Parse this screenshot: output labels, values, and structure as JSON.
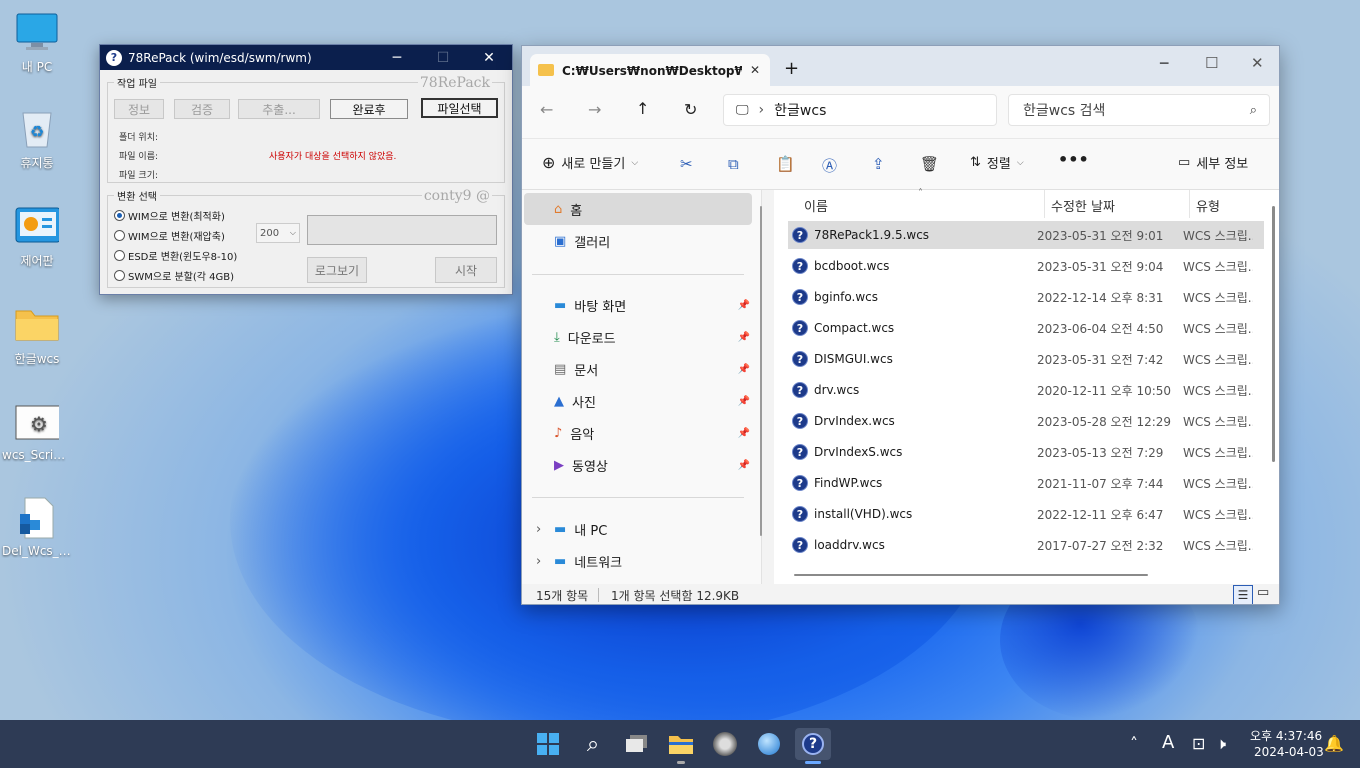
{
  "desktop": {
    "icons": [
      {
        "label": "내 PC",
        "icon": "monitor-icon"
      },
      {
        "label": "휴지통",
        "icon": "recycle-bin-icon"
      },
      {
        "label": "제어판",
        "icon": "control-panel-icon"
      },
      {
        "label": "한글wcs",
        "icon": "folder-icon"
      },
      {
        "label": "wcs_Script...",
        "icon": "settings-file-icon"
      },
      {
        "label": "Del_Wcs_S...",
        "icon": "script-file-icon"
      }
    ]
  },
  "repack": {
    "title": "78RePack (wim/esd/swm/rwm)",
    "group1_label": "작업 파일",
    "watermark1": "78RePack",
    "buttons": {
      "info": "정보",
      "verify": "검증",
      "extract": "추출...",
      "after": "완료후",
      "select": "파일선택"
    },
    "folder_label": "폴더 위치:",
    "name_label": "파일 이름:",
    "size_label": "파일 크기:",
    "status_msg": "사용자가 대상을 선택하지 않았음.",
    "group2_label": "변환 선택",
    "watermark2": "conty9 @",
    "options": [
      "WIM으로 변환(최적화)",
      "WIM으로 변환(재압축)",
      "ESD로 변환(윈도우8-10)",
      "SWM으로 분할(각 4GB)"
    ],
    "selected_option": 0,
    "split_value": "200",
    "log_btn": "로그보기",
    "start_btn": "시작"
  },
  "explorer": {
    "tab_title": "C:₩Users₩non₩Desktop₩한글",
    "address": "한글wcs",
    "search_placeholder": "한글wcs 검색",
    "cmd": {
      "new": "새로 만들기",
      "sort": "정렬",
      "details": "세부 정보"
    },
    "nav": {
      "home": "홈",
      "gallery": "갤러리",
      "quick": [
        {
          "label": "바탕 화면",
          "icon": "desktop-icon"
        },
        {
          "label": "다운로드",
          "icon": "download-icon"
        },
        {
          "label": "문서",
          "icon": "document-icon"
        },
        {
          "label": "사진",
          "icon": "picture-icon"
        },
        {
          "label": "음악",
          "icon": "music-icon"
        },
        {
          "label": "동영상",
          "icon": "video-icon"
        }
      ],
      "pc": "내 PC",
      "network": "네트워크"
    },
    "headers": {
      "name": "이름",
      "date": "수정한 날짜",
      "type": "유형"
    },
    "files": [
      {
        "name": "78RePack1.9.5.wcs",
        "date": "2023-05-31 오전 9:01",
        "type": "WCS 스크립..."
      },
      {
        "name": "bcdboot.wcs",
        "date": "2023-05-31 오전 9:04",
        "type": "WCS 스크립..."
      },
      {
        "name": "bginfo.wcs",
        "date": "2022-12-14 오후 8:31",
        "type": "WCS 스크립..."
      },
      {
        "name": "Compact.wcs",
        "date": "2023-06-04 오전 4:50",
        "type": "WCS 스크립..."
      },
      {
        "name": "DISMGUI.wcs",
        "date": "2023-05-31 오전 7:42",
        "type": "WCS 스크립..."
      },
      {
        "name": "drv.wcs",
        "date": "2020-12-11 오후 10:50",
        "type": "WCS 스크립..."
      },
      {
        "name": "DrvIndex.wcs",
        "date": "2023-05-28 오전 12:29",
        "type": "WCS 스크립..."
      },
      {
        "name": "DrvIndexS.wcs",
        "date": "2023-05-13 오전 7:29",
        "type": "WCS 스크립..."
      },
      {
        "name": "FindWP.wcs",
        "date": "2021-11-07 오후 7:44",
        "type": "WCS 스크립..."
      },
      {
        "name": "install(VHD).wcs",
        "date": "2022-12-11 오후 6:47",
        "type": "WCS 스크립..."
      },
      {
        "name": "loaddrv.wcs",
        "date": "2017-07-27 오전 2:32",
        "type": "WCS 스크립..."
      }
    ],
    "status_count": "15개 항목",
    "status_selected": "1개 항목 선택함 12.9KB"
  },
  "taskbar": {
    "time": "오후 4:37:46",
    "date": "2024-04-03",
    "ime": "A"
  }
}
